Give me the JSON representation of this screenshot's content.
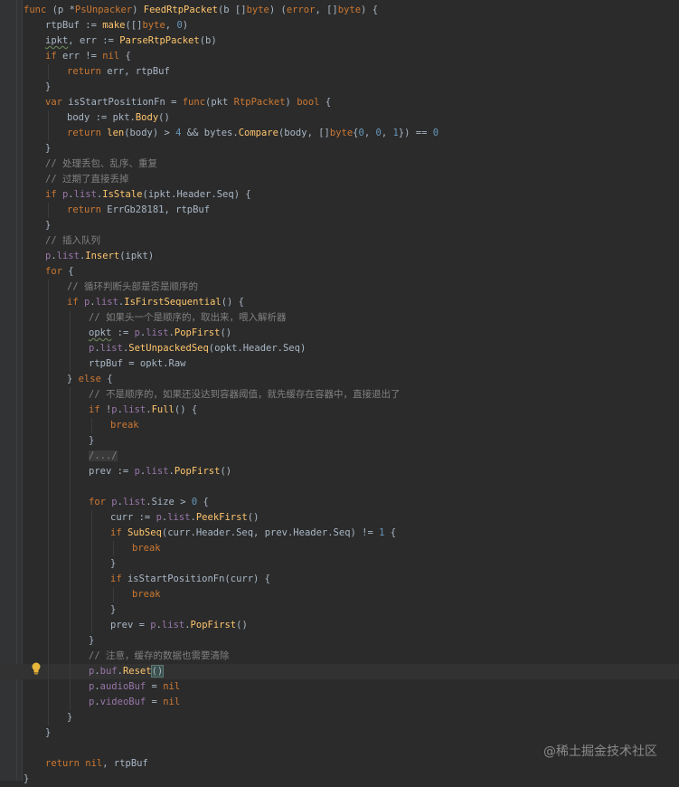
{
  "editor": {
    "lines": [
      {
        "indent": 0,
        "tokens": [
          [
            "kw",
            "func "
          ],
          [
            "t",
            "(p *"
          ],
          [
            "typ",
            "PsUnpacker"
          ],
          [
            "t",
            ") "
          ],
          [
            "fn",
            "FeedRtpPacket"
          ],
          [
            "t",
            "(b []"
          ],
          [
            "kw",
            "byte"
          ],
          [
            "t",
            ") ("
          ],
          [
            "kw",
            "error"
          ],
          [
            "t",
            ", []"
          ],
          [
            "kw",
            "byte"
          ],
          [
            "t",
            ") {"
          ]
        ]
      },
      {
        "indent": 1,
        "tokens": [
          [
            "t",
            "rtpBuf := "
          ],
          [
            "call",
            "make"
          ],
          [
            "t",
            "([]"
          ],
          [
            "kw",
            "byte"
          ],
          [
            "t",
            ", "
          ],
          [
            "num",
            "0"
          ],
          [
            "t",
            ")"
          ]
        ]
      },
      {
        "indent": 1,
        "tokens": [
          [
            "sq",
            "ipkt"
          ],
          [
            "t",
            ", err := "
          ],
          [
            "call",
            "ParseRtpPacket"
          ],
          [
            "t",
            "(b)"
          ]
        ]
      },
      {
        "indent": 1,
        "tokens": [
          [
            "kw",
            "if "
          ],
          [
            "t",
            "err != "
          ],
          [
            "kw",
            "nil"
          ],
          [
            "t",
            " {"
          ]
        ]
      },
      {
        "indent": 2,
        "tokens": [
          [
            "kw",
            "return "
          ],
          [
            "t",
            "err, rtpBuf"
          ]
        ]
      },
      {
        "indent": 1,
        "tokens": [
          [
            "t",
            "}"
          ]
        ]
      },
      {
        "indent": 1,
        "tokens": [
          [
            "kw",
            "var "
          ],
          [
            "t",
            "isStartPositionFn = "
          ],
          [
            "kw",
            "func"
          ],
          [
            "t",
            "(pkt "
          ],
          [
            "typ",
            "RtpPacket"
          ],
          [
            "t",
            ") "
          ],
          [
            "kw",
            "bool"
          ],
          [
            "t",
            " {"
          ]
        ]
      },
      {
        "indent": 2,
        "tokens": [
          [
            "t",
            "body := pkt."
          ],
          [
            "call",
            "Body"
          ],
          [
            "t",
            "()"
          ]
        ]
      },
      {
        "indent": 2,
        "tokens": [
          [
            "kw",
            "return "
          ],
          [
            "call",
            "len"
          ],
          [
            "t",
            "(body) > "
          ],
          [
            "num",
            "4"
          ],
          [
            "t",
            " && "
          ],
          [
            "t",
            "bytes."
          ],
          [
            "call",
            "Compare"
          ],
          [
            "t",
            "(body, []"
          ],
          [
            "kw",
            "byte"
          ],
          [
            "t",
            "{"
          ],
          [
            "num",
            "0"
          ],
          [
            "t",
            ", "
          ],
          [
            "num",
            "0"
          ],
          [
            "t",
            ", "
          ],
          [
            "num",
            "1"
          ],
          [
            "t",
            "}) == "
          ],
          [
            "num",
            "0"
          ]
        ]
      },
      {
        "indent": 1,
        "tokens": [
          [
            "t",
            "}"
          ]
        ]
      },
      {
        "indent": 1,
        "tokens": [
          [
            "cmt",
            "// 处理丢包、乱序、重复"
          ]
        ]
      },
      {
        "indent": 1,
        "tokens": [
          [
            "cmt",
            "// 过期了直接丢掉"
          ]
        ]
      },
      {
        "indent": 1,
        "tokens": [
          [
            "kw",
            "if "
          ],
          [
            "fld",
            "p"
          ],
          [
            "t",
            "."
          ],
          [
            "fld",
            "list"
          ],
          [
            "t",
            "."
          ],
          [
            "call",
            "IsStale"
          ],
          [
            "t",
            "(ipkt."
          ],
          [
            "t",
            "Header"
          ],
          [
            "t",
            "."
          ],
          [
            "t",
            "Seq"
          ],
          [
            "t",
            ") {"
          ]
        ]
      },
      {
        "indent": 2,
        "tokens": [
          [
            "kw",
            "return "
          ],
          [
            "t",
            "ErrGb28181, rtpBuf"
          ]
        ]
      },
      {
        "indent": 1,
        "tokens": [
          [
            "t",
            "}"
          ]
        ]
      },
      {
        "indent": 1,
        "tokens": [
          [
            "cmt",
            "// 插入队列"
          ]
        ]
      },
      {
        "indent": 1,
        "tokens": [
          [
            "fld",
            "p"
          ],
          [
            "t",
            "."
          ],
          [
            "fld",
            "list"
          ],
          [
            "t",
            "."
          ],
          [
            "call",
            "Insert"
          ],
          [
            "t",
            "(ipkt)"
          ]
        ]
      },
      {
        "indent": 1,
        "tokens": [
          [
            "kw",
            "for "
          ],
          [
            "t",
            "{"
          ]
        ]
      },
      {
        "indent": 2,
        "tokens": [
          [
            "cmt",
            "// 循环判断头部是否是顺序的"
          ]
        ]
      },
      {
        "indent": 2,
        "tokens": [
          [
            "kw",
            "if "
          ],
          [
            "fld",
            "p"
          ],
          [
            "t",
            "."
          ],
          [
            "fld",
            "list"
          ],
          [
            "t",
            "."
          ],
          [
            "call",
            "IsFirstSequential"
          ],
          [
            "t",
            "() {"
          ]
        ]
      },
      {
        "indent": 3,
        "tokens": [
          [
            "cmt",
            "// 如果头一个是顺序的，取出来，喂入解析器"
          ]
        ]
      },
      {
        "indent": 3,
        "tokens": [
          [
            "sq",
            "opkt"
          ],
          [
            "t",
            " := "
          ],
          [
            "fld",
            "p"
          ],
          [
            "t",
            "."
          ],
          [
            "fld",
            "list"
          ],
          [
            "t",
            "."
          ],
          [
            "call",
            "PopFirst"
          ],
          [
            "t",
            "()"
          ]
        ]
      },
      {
        "indent": 3,
        "tokens": [
          [
            "fld",
            "p"
          ],
          [
            "t",
            "."
          ],
          [
            "fld",
            "list"
          ],
          [
            "t",
            "."
          ],
          [
            "call",
            "SetUnpackedSeq"
          ],
          [
            "t",
            "(opkt.Header.Seq)"
          ]
        ]
      },
      {
        "indent": 3,
        "tokens": [
          [
            "t",
            "rtpBuf = opkt.Raw"
          ]
        ]
      },
      {
        "indent": 2,
        "tokens": [
          [
            "t",
            "} "
          ],
          [
            "kw",
            "else "
          ],
          [
            "t",
            "{"
          ]
        ]
      },
      {
        "indent": 3,
        "tokens": [
          [
            "cmt",
            "// 不是顺序的，如果还没达到容器阈值，就先缓存在容器中，直接退出了"
          ]
        ]
      },
      {
        "indent": 3,
        "tokens": [
          [
            "kw",
            "if "
          ],
          [
            "t",
            "!"
          ],
          [
            "fld",
            "p"
          ],
          [
            "t",
            "."
          ],
          [
            "fld",
            "list"
          ],
          [
            "t",
            "."
          ],
          [
            "call",
            "Full"
          ],
          [
            "t",
            "() {"
          ]
        ]
      },
      {
        "indent": 4,
        "tokens": [
          [
            "kw",
            "break"
          ]
        ]
      },
      {
        "indent": 3,
        "tokens": [
          [
            "t",
            "}"
          ]
        ]
      },
      {
        "indent": 3,
        "tokens": [
          [
            "fold",
            "/.../"
          ]
        ]
      },
      {
        "indent": 3,
        "tokens": [
          [
            "t",
            "prev := "
          ],
          [
            "fld",
            "p"
          ],
          [
            "t",
            "."
          ],
          [
            "fld",
            "list"
          ],
          [
            "t",
            "."
          ],
          [
            "call",
            "PopFirst"
          ],
          [
            "t",
            "()"
          ]
        ]
      },
      {
        "indent": 3,
        "tokens": []
      },
      {
        "indent": 3,
        "tokens": [
          [
            "kw",
            "for "
          ],
          [
            "fld",
            "p"
          ],
          [
            "t",
            "."
          ],
          [
            "fld",
            "list"
          ],
          [
            "t",
            "."
          ],
          [
            "t",
            "Size"
          ],
          [
            "t",
            " > "
          ],
          [
            "num",
            "0"
          ],
          [
            "t",
            " {"
          ]
        ]
      },
      {
        "indent": 4,
        "tokens": [
          [
            "t",
            "curr := "
          ],
          [
            "fld",
            "p"
          ],
          [
            "t",
            "."
          ],
          [
            "fld",
            "list"
          ],
          [
            "t",
            "."
          ],
          [
            "call",
            "PeekFirst"
          ],
          [
            "t",
            "()"
          ]
        ]
      },
      {
        "indent": 4,
        "tokens": [
          [
            "kw",
            "if "
          ],
          [
            "call",
            "SubSeq"
          ],
          [
            "t",
            "(curr.Header.Seq, prev.Header.Seq) != "
          ],
          [
            "num",
            "1"
          ],
          [
            "t",
            " {"
          ]
        ]
      },
      {
        "indent": 5,
        "tokens": [
          [
            "kw",
            "break"
          ]
        ]
      },
      {
        "indent": 4,
        "tokens": [
          [
            "t",
            "}"
          ]
        ]
      },
      {
        "indent": 4,
        "tokens": [
          [
            "kw",
            "if "
          ],
          [
            "t",
            "isStartPositionFn(curr) {"
          ]
        ]
      },
      {
        "indent": 5,
        "tokens": [
          [
            "kw",
            "break"
          ]
        ]
      },
      {
        "indent": 4,
        "tokens": [
          [
            "t",
            "}"
          ]
        ]
      },
      {
        "indent": 4,
        "tokens": [
          [
            "t",
            "prev = "
          ],
          [
            "fld",
            "p"
          ],
          [
            "t",
            "."
          ],
          [
            "fld",
            "list"
          ],
          [
            "t",
            "."
          ],
          [
            "call",
            "PopFirst"
          ],
          [
            "t",
            "()"
          ]
        ]
      },
      {
        "indent": 3,
        "tokens": [
          [
            "t",
            "}"
          ]
        ]
      },
      {
        "indent": 3,
        "tokens": [
          [
            "cmt",
            "// 注意，缓存的数据也需要清除"
          ]
        ]
      },
      {
        "indent": 3,
        "current": true,
        "tokens": [
          [
            "fld",
            "p"
          ],
          [
            "t",
            "."
          ],
          [
            "fld",
            "buf"
          ],
          [
            "t",
            "."
          ],
          [
            "call",
            "Reset"
          ],
          [
            "hl",
            "()"
          ]
        ]
      },
      {
        "indent": 3,
        "tokens": [
          [
            "fld",
            "p"
          ],
          [
            "t",
            "."
          ],
          [
            "fld",
            "audioBuf"
          ],
          [
            "t",
            " = "
          ],
          [
            "kw",
            "nil"
          ]
        ]
      },
      {
        "indent": 3,
        "tokens": [
          [
            "fld",
            "p"
          ],
          [
            "t",
            "."
          ],
          [
            "fld",
            "videoBuf"
          ],
          [
            "t",
            " = "
          ],
          [
            "kw",
            "nil"
          ]
        ]
      },
      {
        "indent": 2,
        "tokens": [
          [
            "t",
            "}"
          ]
        ]
      },
      {
        "indent": 1,
        "tokens": [
          [
            "t",
            "}"
          ]
        ]
      },
      {
        "indent": 1,
        "tokens": []
      },
      {
        "indent": 1,
        "tokens": [
          [
            "kw",
            "return "
          ],
          [
            "kw",
            "nil"
          ],
          [
            "t",
            ", rtpBuf"
          ]
        ]
      },
      {
        "indent": 0,
        "tokens": [
          [
            "t",
            "}"
          ]
        ]
      }
    ]
  },
  "watermark": "@稀土掘金技术社区",
  "icons": {
    "intention": "lightbulb-icon"
  }
}
